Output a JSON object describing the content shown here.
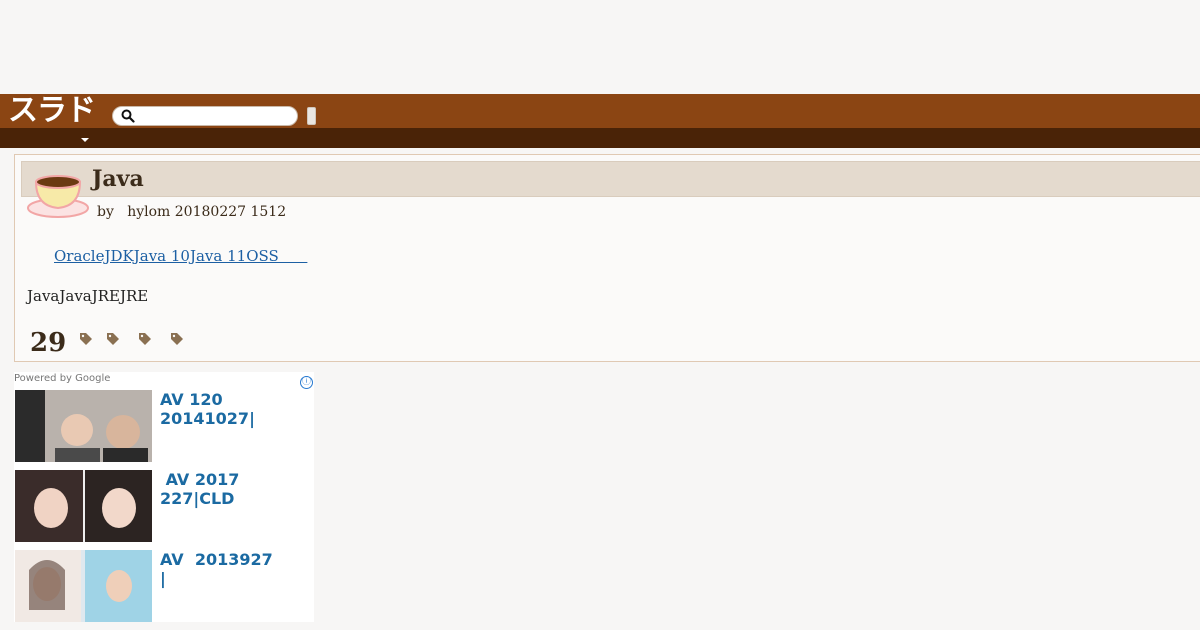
{
  "header": {
    "logo": "スラド",
    "search": {
      "placeholder": "",
      "value": ""
    }
  },
  "colors": {
    "header_bg": "#8b4513",
    "subnav_bg": "#4a2307",
    "title_bar_bg": "#e4dace",
    "link": "#1c5fa3",
    "ad_link": "#1b6aa2"
  },
  "article": {
    "topic_icon": "java-coffee-cup-icon",
    "title": "Java",
    "byline": "by   hylom 20180227 1512",
    "link_text": "OracleJDKJava 10Java 11OSS      ",
    "body": "JavaJavaJREJRE",
    "comment_count": "29",
    "tags": [
      "tag-icon",
      "tag-icon",
      "tag-icon",
      "tag-icon"
    ]
  },
  "ads": {
    "powered_by": "Powered by Google",
    "info_icon": "ⓘ",
    "items": [
      {
        "text": "AV 120\n20141027|"
      },
      {
        "text": " AV 2017\n227|CLD"
      },
      {
        "text": "AV  2013927\n|"
      }
    ]
  }
}
